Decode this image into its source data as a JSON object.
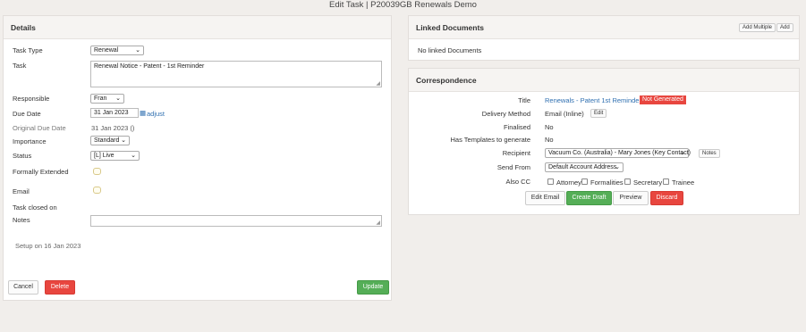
{
  "window": {
    "title": "Edit Task | P20039GB Renewals Demo"
  },
  "details": {
    "header": "Details",
    "task_type_label": "Task Type",
    "task_type_value": "Renewal",
    "task_label": "Task",
    "task_value": "Renewal Notice - Patent - 1st Reminder",
    "responsible_label": "Responsible",
    "responsible_value": "Fran",
    "due_date_label": "Due Date",
    "due_date_value": "31 Jan 2023",
    "adjust_label": "adjust",
    "original_due_label": "Original Due Date",
    "original_due_value": "31 Jan 2023 ()",
    "importance_label": "Importance",
    "importance_value": "Standard",
    "status_label": "Status",
    "status_value": "[L] Live",
    "formally_extended_label": "Formally Extended",
    "email_label": "Email",
    "task_closed_label": "Task closed on",
    "notes_label": "Notes",
    "notes_value": "",
    "setup_text": "Setup on 16 Jan 2023",
    "cancel_label": "Cancel",
    "delete_label": "Delete",
    "update_label": "Update"
  },
  "linked_documents": {
    "header": "Linked Documents",
    "add_multiple_label": "Add Multiple",
    "add_label": "Add",
    "empty_text": "No linked Documents"
  },
  "correspondence": {
    "header": "Correspondence",
    "title_label": "Title",
    "title_value": "Renewals - Patent 1st Reminder",
    "status_badge": "Not Generated",
    "delivery_label": "Delivery Method",
    "delivery_value": "Email (Inline)",
    "edit_label": "Edit",
    "finalised_label": "Finalised",
    "finalised_value": "No",
    "templates_label": "Has Templates to generate",
    "templates_value": "No",
    "recipient_label": "Recipient",
    "recipient_value": "Vacuum Co. (Australia) - Mary Jones (Key Contact)",
    "notes_btn_label": "Notes",
    "send_from_label": "Send From",
    "send_from_value": "Default Account Address",
    "also_cc_label": "Also CC",
    "cc_options": [
      "Attorney",
      "Formalities",
      "Secretary",
      "Trainee"
    ],
    "edit_email_label": "Edit Email",
    "create_draft_label": "Create Draft",
    "preview_label": "Preview",
    "discard_label": "Discard"
  }
}
